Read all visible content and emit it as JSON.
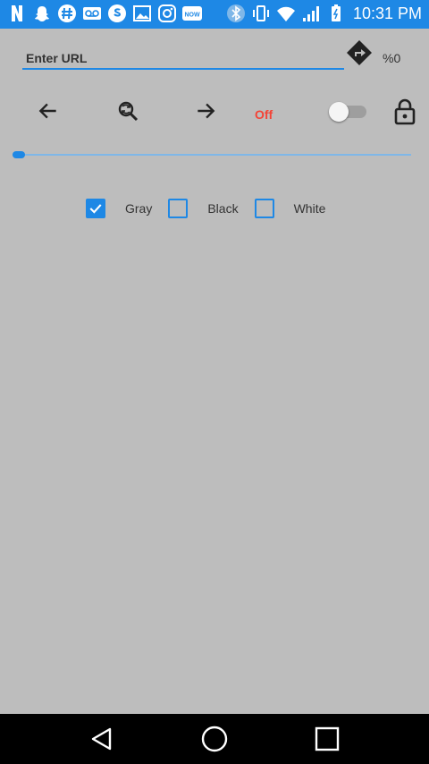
{
  "status_bar": {
    "time": "10:31 PM",
    "left_icons": [
      "netflix-icon",
      "snapchat-icon",
      "hashtag-icon",
      "voicemail-icon",
      "skype-icon",
      "image-icon",
      "instagram-icon",
      "now-icon"
    ],
    "right_icons": [
      "bluetooth-icon",
      "vibrate-icon",
      "wifi-icon",
      "signal-icon",
      "battery-icon"
    ],
    "now_badge": "NOW"
  },
  "url_bar": {
    "placeholder": "Enter URL",
    "value": "",
    "progress_text": "%0"
  },
  "nav": {
    "off_label": "Off",
    "switch_on": false
  },
  "progress": {
    "fraction": 0.02
  },
  "filters": {
    "options": [
      {
        "label": "Gray",
        "checked": true
      },
      {
        "label": "Black",
        "checked": false
      },
      {
        "label": "White",
        "checked": false
      }
    ]
  },
  "colors": {
    "accent": "#1e88e5",
    "background": "#bdbdbd",
    "off_text": "#f44336"
  }
}
